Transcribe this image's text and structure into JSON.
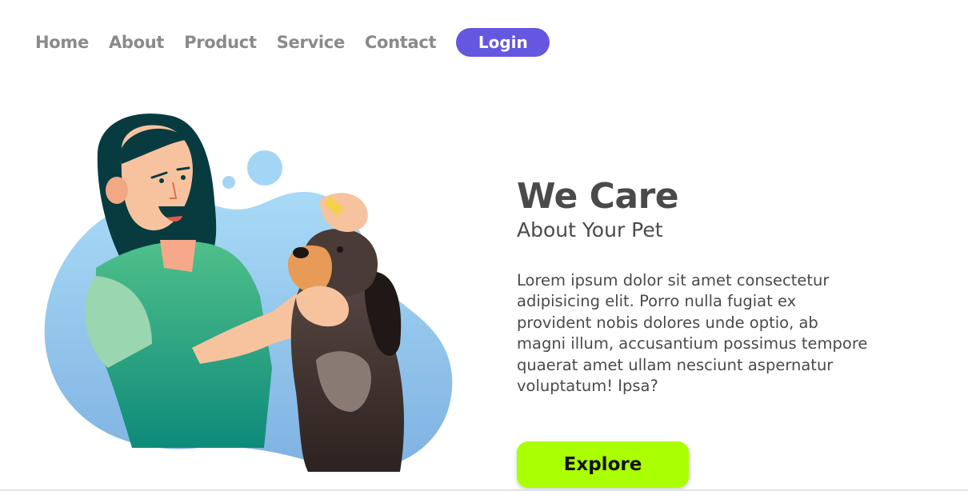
{
  "nav": {
    "links": [
      "Home",
      "About",
      "Product",
      "Service",
      "Contact"
    ],
    "login_label": "Login"
  },
  "hero": {
    "title": "We Care",
    "subtitle": "About Your Pet",
    "body": "Lorem ipsum dolor sit amet consectetur adipisicing elit. Porro nulla fugiat ex provident nobis dolores unde optio, ab magni illum, accusantium possimus tempore quaerat amet ullam nesciunt aspernatur voluptatum! Ipsa?",
    "explore_label": "Explore"
  },
  "colors": {
    "accent": "#6557e0",
    "explore": "#aaff00",
    "text": "#4a4a4a",
    "nav_text": "#8a8a8a",
    "blob": "#8ec8ee"
  }
}
